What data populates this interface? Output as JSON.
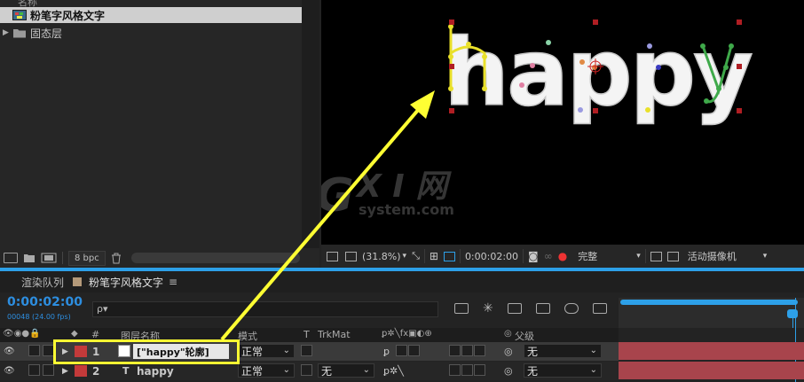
{
  "project": {
    "header_partial": "名称",
    "items": [
      {
        "label": "粉笔字风格文字",
        "type": "composition",
        "selected": true
      },
      {
        "label": "固态层",
        "type": "folder",
        "selected": false
      }
    ],
    "footer": {
      "bpc_label": "8 bpc"
    }
  },
  "viewer": {
    "word": "happy",
    "watermark_main": "G X I 网",
    "watermark_sub": "system.com",
    "controls": {
      "zoom": "(31.8%)",
      "timecode": "0:00:02:00",
      "quality": "完整",
      "camera": "活动摄像机"
    }
  },
  "timeline": {
    "tabs": [
      {
        "label": "渲染队列",
        "active": false
      },
      {
        "label": "粉笔字风格文字",
        "active": true
      }
    ],
    "current_time": "0:00:02:00",
    "frame_info": "00048 (24.00 fps)",
    "search_placeholder": "ρ▾",
    "columns": {
      "num": "#",
      "layer_name": "图层名称",
      "mode": "模式",
      "t": "T",
      "trkmat": "TrkMat",
      "parent": "父级"
    },
    "layers": [
      {
        "num": "1",
        "name": "[\"happy\"轮廓]",
        "mode": "正常",
        "trkmat": "",
        "parent": "无",
        "label_color": "#c43a3a",
        "highlighted": true
      },
      {
        "num": "2",
        "name": "happy",
        "mode": "正常",
        "trkmat": "无",
        "parent": "无",
        "label_color": "#c43a3a",
        "highlighted": false
      }
    ]
  },
  "colors": {
    "accent_blue": "#2da0e8",
    "annotation_yellow": "#ffff33",
    "layer_bar": "#a8444c",
    "handle_red": "#b01e23"
  }
}
